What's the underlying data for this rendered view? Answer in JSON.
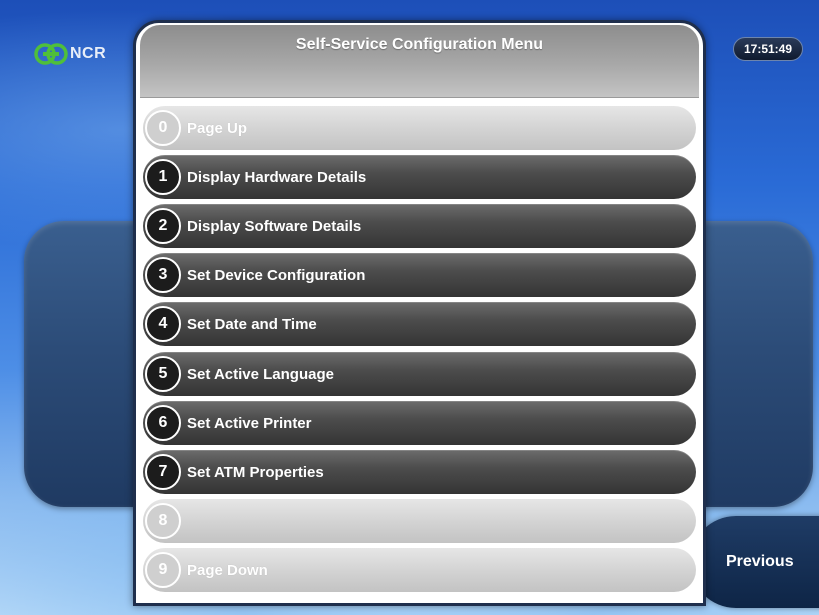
{
  "brand": {
    "logo_text": "NCR"
  },
  "clock": {
    "time": "17:51:49"
  },
  "menu": {
    "title": "Self-Service Configuration Menu",
    "items": [
      {
        "key": "0",
        "label": "Page Up",
        "style": "light"
      },
      {
        "key": "1",
        "label": "Display Hardware Details",
        "style": "dark"
      },
      {
        "key": "2",
        "label": "Display Software Details",
        "style": "dark"
      },
      {
        "key": "3",
        "label": "Set Device Configuration",
        "style": "dark"
      },
      {
        "key": "4",
        "label": "Set Date and Time",
        "style": "dark"
      },
      {
        "key": "5",
        "label": "Set Active Language",
        "style": "dark"
      },
      {
        "key": "6",
        "label": "Set Active Printer",
        "style": "dark"
      },
      {
        "key": "7",
        "label": "Set ATM Properties",
        "style": "dark"
      },
      {
        "key": "8",
        "label": "",
        "style": "light"
      },
      {
        "key": "9",
        "label": "Page Down",
        "style": "light"
      }
    ]
  },
  "nav": {
    "previous_label": "Previous"
  },
  "colors": {
    "background_blue": "#1d4fb8",
    "item_dark": "#4d4d4d",
    "item_light": "#d2d2d2",
    "header_gray": "#a8a8a8",
    "logo_green": "#4fbf3a"
  }
}
